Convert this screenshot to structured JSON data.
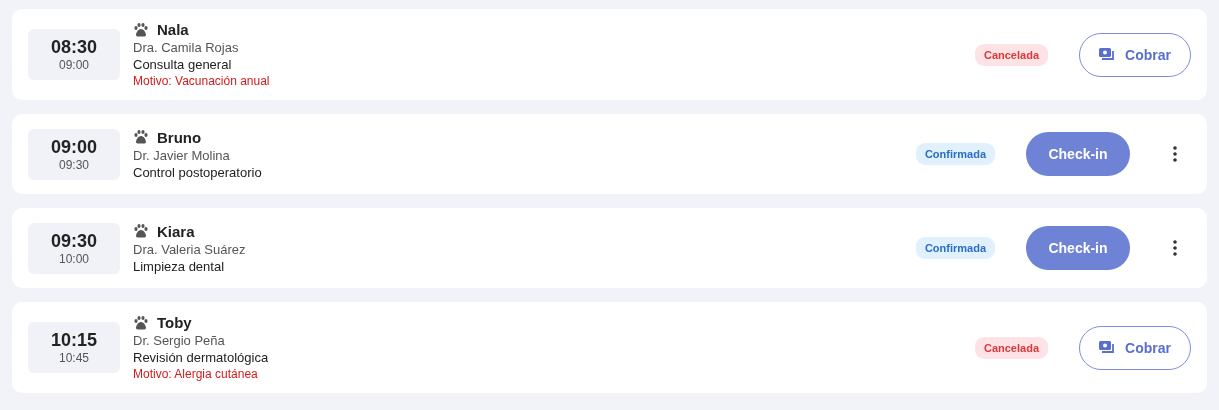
{
  "appointments": [
    {
      "start": "08:30",
      "end": "09:00",
      "pet": "Nala",
      "vet": "Dra. Camila Rojas",
      "service": "Consulta general",
      "reason": "Motivo: Vacunación anual",
      "status": {
        "kind": "cancelled",
        "label": "Cancelada"
      },
      "action": {
        "kind": "charge",
        "label": "Cobrar"
      },
      "menu": false
    },
    {
      "start": "09:00",
      "end": "09:30",
      "pet": "Bruno",
      "vet": "Dr. Javier Molina",
      "service": "Control postoperatorio",
      "status": {
        "kind": "confirmed",
        "label": "Confirmada"
      },
      "action": {
        "kind": "checkin",
        "label": "Check-in"
      },
      "menu": true
    },
    {
      "start": "09:30",
      "end": "10:00",
      "pet": "Kiara",
      "vet": "Dra. Valeria Suárez",
      "service": "Limpieza dental",
      "status": {
        "kind": "confirmed",
        "label": "Confirmada"
      },
      "action": {
        "kind": "checkin",
        "label": "Check-in"
      },
      "menu": true
    },
    {
      "start": "10:15",
      "end": "10:45",
      "pet": "Toby",
      "vet": "Dr. Sergio Peña",
      "service": "Revisión dermatológica",
      "reason": "Motivo: Alergia cutánea",
      "status": {
        "kind": "cancelled",
        "label": "Cancelada"
      },
      "action": {
        "kind": "charge",
        "label": "Cobrar"
      },
      "menu": false
    }
  ]
}
